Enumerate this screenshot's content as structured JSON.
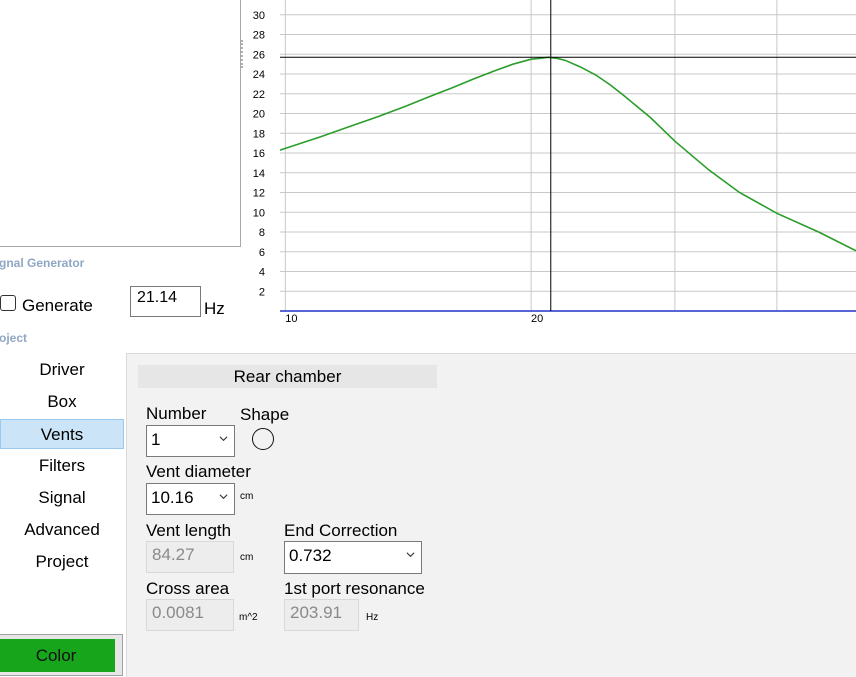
{
  "signal_generator": {
    "caption": "gnal Generator",
    "generate_label": "Generate",
    "frequency_value": "21.14",
    "frequency_unit": "Hz",
    "generate_checked": false
  },
  "project_caption": "oject",
  "nav": {
    "items": [
      {
        "label": "Driver"
      },
      {
        "label": "Box"
      },
      {
        "label": "Vents",
        "active": true
      },
      {
        "label": "Filters"
      },
      {
        "label": "Signal"
      },
      {
        "label": "Advanced"
      },
      {
        "label": "Project"
      }
    ],
    "color_button_label": "Color",
    "color_button_color": "#17a51c"
  },
  "vents": {
    "header": "Rear chamber",
    "number_label": "Number",
    "number_value": "1",
    "shape_label": "Shape",
    "shape_icon": "circle-icon",
    "diameter_label": "Vent diameter",
    "diameter_value": "10.16",
    "diameter_unit": "cm",
    "length_label": "Vent length",
    "length_value": "84.27",
    "length_unit": "cm",
    "end_correction_label": "End Correction",
    "end_correction_value": "0.732",
    "cross_area_label": "Cross area",
    "cross_area_value": "0.0081",
    "cross_area_unit": "m^2",
    "port_resonance_label": "1st port resonance",
    "port_resonance_value": "203.91",
    "port_resonance_unit": "Hz"
  },
  "chart_data": {
    "type": "line",
    "xscale": "log",
    "xlim": [
      9.85,
      50
    ],
    "ylim": [
      0,
      31.5
    ],
    "y_ticks": [
      2,
      4,
      6,
      8,
      10,
      12,
      14,
      16,
      18,
      20,
      22,
      24,
      26,
      28,
      30
    ],
    "x_tick_labels": [
      {
        "x": 10,
        "label": "10"
      },
      {
        "x": 20,
        "label": "20"
      }
    ],
    "x_gridlines": [
      10,
      20,
      21.14,
      30,
      40
    ],
    "grid": true,
    "cursor": {
      "x": 21.14,
      "y": 25.7
    },
    "series": [
      {
        "color": "#2a9d2a",
        "x": [
          9.85,
          11,
          12,
          13,
          14,
          15,
          16,
          17,
          18,
          19,
          20,
          20.5,
          21,
          21.5,
          22,
          23,
          24,
          25,
          26,
          28,
          30,
          33,
          36,
          40,
          45,
          50
        ],
        "y": [
          16.3,
          17.6,
          18.7,
          19.7,
          20.7,
          21.7,
          22.6,
          23.5,
          24.3,
          25.0,
          25.5,
          25.6,
          25.7,
          25.6,
          25.4,
          24.7,
          23.9,
          22.9,
          21.8,
          19.6,
          17.2,
          14.3,
          12.0,
          9.9,
          8.0,
          6.1
        ]
      }
    ]
  }
}
